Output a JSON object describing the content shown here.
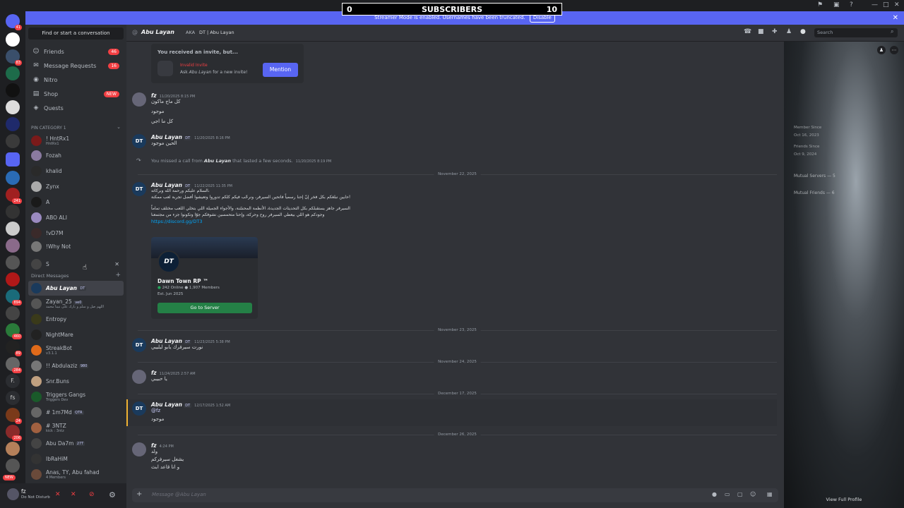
{
  "overlay": {
    "left_count": "0",
    "title": "SUBSCRIBERS",
    "right_count": "10"
  },
  "banner": {
    "text": "Streamer Mode is enabled. Usernames have been truncated.",
    "disable": "Disable"
  },
  "rail_badges": [
    "41",
    "83",
    "241",
    "6",
    "53",
    "894",
    "460",
    "89",
    "284",
    "206",
    "24"
  ],
  "dmcol": {
    "find": "Find or start a conversation",
    "nav": [
      {
        "icon": "friends-icon",
        "label": "Friends",
        "badge": "46"
      },
      {
        "icon": "message-requests-icon",
        "label": "Message Requests",
        "badge": "16"
      },
      {
        "icon": "nitro-icon",
        "label": "Nitro",
        "badge": ""
      },
      {
        "icon": "shop-icon",
        "label": "Shop",
        "badge": "NEW"
      },
      {
        "icon": "quests-icon",
        "label": "Quests",
        "badge": ""
      }
    ],
    "pin_category": "PIN CATEGORY 1",
    "pinned": [
      {
        "name": "! HntRx1",
        "sub": "HntRx1"
      },
      {
        "name": "Fozah",
        "sub": ""
      },
      {
        "name": "khalid",
        "sub": ""
      },
      {
        "name": "Zynx",
        "sub": ""
      },
      {
        "name": "A",
        "sub": ""
      },
      {
        "name": "ABO ALI",
        "sub": ""
      },
      {
        "name": "!vD7M",
        "sub": ""
      },
      {
        "name": "!Why Not",
        "sub": ""
      },
      {
        "name": "S",
        "sub": ""
      }
    ],
    "direct_messages": "Direct Messages",
    "dms": [
      {
        "name": "Abu Layan",
        "sub": "",
        "tag": "DT"
      },
      {
        "name": "Zayan_25",
        "sub": "اللهم صل و سلم و بارك على نبينا محمد",
        "tag": "ve0"
      },
      {
        "name": "Entropy",
        "sub": "",
        "tag": ""
      },
      {
        "name": "NightMare",
        "sub": "",
        "tag": ""
      },
      {
        "name": "StreakBot",
        "sub": "v3.1.1",
        "tag": ""
      },
      {
        "name": "!! Abdulaziz",
        "sub": "",
        "tag": "980"
      },
      {
        "name": "Snr.Buns",
        "sub": "",
        "tag": ""
      },
      {
        "name": "Triggers Gangs",
        "sub": "Triggers Dev",
        "tag": ""
      },
      {
        "name": "# 1m7Md",
        "sub": "",
        "tag": "QTR"
      },
      {
        "name": "# 3NTZ",
        "sub": "kick : 3ntz",
        "tag": ""
      },
      {
        "name": "Abu Da7m",
        "sub": "",
        "tag": "27T"
      },
      {
        "name": "IbRaHiM",
        "sub": "",
        "tag": ""
      },
      {
        "name": "Anas, TY, Abu fahad",
        "sub": "4 Members",
        "tag": ""
      }
    ]
  },
  "user": {
    "name": "fz",
    "status": "Do Not Disturb",
    "new": "NEW"
  },
  "header": {
    "name": "Abu Layan",
    "aka": "AKA",
    "aka_value": "DT | Abu Layan",
    "search": "Search"
  },
  "invite": {
    "title": "You received an invite, but...",
    "invalid": "Invalid Invite",
    "ask": "Ask",
    "ask_name": "Abu Layan",
    "ask_rest": "for a new invite!",
    "mention": "Mention"
  },
  "messages": [
    {
      "author": "fz",
      "time": "11/20/2025 8:15 PM",
      "lines": [
        "كل ماج ماكون",
        "موجود",
        "كل ما اجي"
      ]
    },
    {
      "author": "Abu Layan",
      "tag": "DT",
      "time": "11/20/2025 8:16 PM",
      "lines": [
        "الحين موجود"
      ]
    },
    {
      "call": "You missed a call from",
      "call_name": "Abu Layan",
      "call_rest": "that lasted a few seconds.",
      "time": "11/20/2025 8:19 PM"
    },
    {
      "author": "Abu Layan",
      "tag": "DT",
      "time": "11/22/2025 11:35 PM",
      "lines": [
        "السلام عليكم ورحمة الله وبركاته،",
        "حابين نبلغكم بكل فخر إنّ إحنا رسمياً فاتحين السيرفر، ونرحّب فيكم كلكم تدوروا وتعيشوا أفضل تجربة لعب ممكنة!",
        "السيرفر جاهز يستقبلكم بكل التحديثات الجديدة، الأنظمة المحسّنة، والأجواء الجميلة اللي بتخلي اللعب مختلف تماماً",
        "وجودكم هو اللي بيعطي السيرفر روح وحركة، وإحنا متحمسين نشوفكم جوّا وتكونوا جزء من مجتمعنا"
      ],
      "link": "https://discord.gg/DT3"
    },
    {
      "author": "Abu Layan",
      "tag": "DT",
      "time": "11/23/2025 5:38 PM",
      "lines": [
        "نورت سيرفرك يابو ليلييي"
      ]
    },
    {
      "author": "fz",
      "time": "11/24/2025 2:57 AM",
      "lines": [
        "يا حبيبي"
      ]
    },
    {
      "author": "Abu Layan",
      "tag": "DT",
      "time": "12/17/2025 1:52 AM",
      "lines": [
        "@fz",
        "موجود"
      ]
    },
    {
      "author": "fz",
      "time": "4:24 PM",
      "lines": [
        "ولد",
        "يشغل سيرفركم",
        "و انا قاعد ابث"
      ]
    }
  ],
  "server_card": {
    "name": "Dawn Town RP ™",
    "online": "242 Online",
    "members": "1,907 Members",
    "est": "Est. Jun 2025",
    "button": "Go to Server"
  },
  "dates": [
    "November 22, 2025",
    "November 23, 2025",
    "November 24, 2025",
    "December 17, 2025",
    "December 26, 2025"
  ],
  "composer": {
    "placeholder": "Message @Abu Layan"
  },
  "profile": {
    "member_since": "Member Since",
    "date1": "Oct 16, 2023",
    "friends_since": "Friends Since",
    "date2": "Oct 9, 2024",
    "mutual_servers": "Mutual Servers — 5",
    "mutual_friends": "Mutual Friends — 6",
    "view_full": "View Full Profile"
  }
}
